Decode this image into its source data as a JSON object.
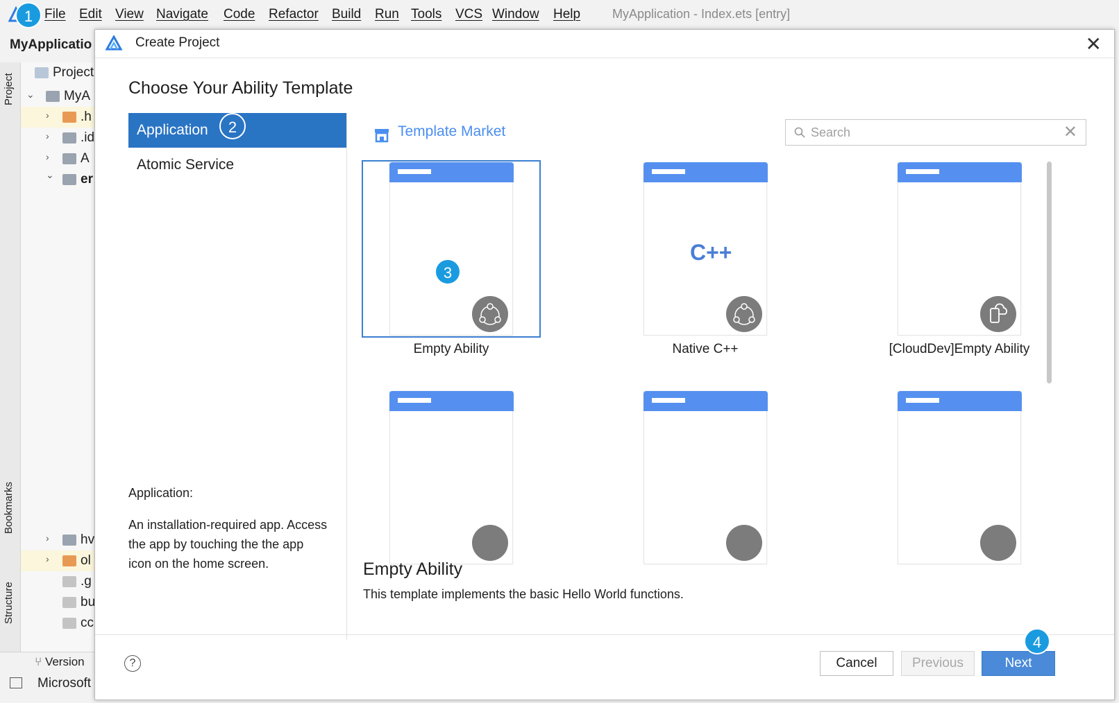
{
  "menubar": {
    "items": [
      "File",
      "Edit",
      "View",
      "Navigate",
      "Code",
      "Refactor",
      "Build",
      "Run",
      "Tools",
      "VCS",
      "Window",
      "Help"
    ],
    "window_title": "MyApplication - Index.ets [entry]"
  },
  "ide": {
    "project_name": "MyApplicatio",
    "project_tab": "Project",
    "tree": [
      ".h",
      ".id",
      "A",
      "er",
      "hv",
      "ol",
      ".g",
      "bu",
      "cc"
    ],
    "tree_root": "MyA",
    "side_tabs": [
      "Project",
      "Bookmarks",
      "Structure"
    ],
    "bottom_items": [
      "Version",
      "Microsoft"
    ]
  },
  "dialog": {
    "title": "Create Project",
    "close_glyph": "✕",
    "heading": "Choose Your Ability Template",
    "categories": [
      "Application",
      "Atomic Service"
    ],
    "category_desc_title": "Application:",
    "category_desc": "An installation-required app. Access the app by touching the the app icon on the home screen.",
    "market_label": "Template Market",
    "search_placeholder": "Search",
    "search_clear": "✕",
    "templates": [
      {
        "name": "Empty Ability"
      },
      {
        "name": "Native C++"
      },
      {
        "name": "[CloudDev]Empty Ability"
      },
      {
        "name": ""
      },
      {
        "name": ""
      },
      {
        "name": ""
      }
    ],
    "cpp_glyph": "C++",
    "selected_title": "Empty Ability",
    "selected_desc": "This template implements the basic Hello World functions.",
    "help_glyph": "?",
    "buttons": {
      "cancel": "Cancel",
      "previous": "Previous",
      "next": "Next"
    }
  },
  "steps": [
    "1",
    "2",
    "3",
    "4"
  ],
  "colors": {
    "accent": "#2a74c4",
    "template_bar": "#5590f0",
    "market_link": "#4a8ef0",
    "step_marker": "#1a9be0"
  }
}
